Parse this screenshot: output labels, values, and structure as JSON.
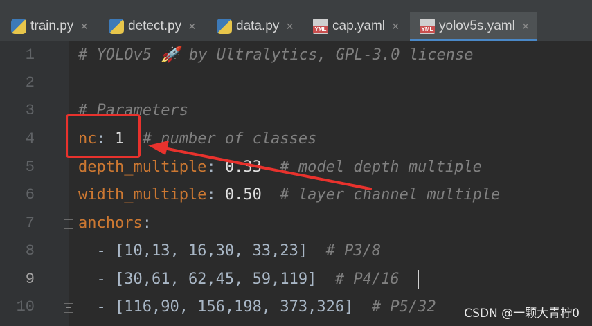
{
  "tabs": [
    {
      "label": "train.py",
      "icon": "python-file-icon"
    },
    {
      "label": "detect.py",
      "icon": "python-file-icon"
    },
    {
      "label": "data.py",
      "icon": "python-file-icon"
    },
    {
      "label": "cap.yaml",
      "icon": "yaml-file-icon"
    },
    {
      "label": "yolov5s.yaml",
      "icon": "yaml-file-icon",
      "active": true
    }
  ],
  "tab_close": "×",
  "yml_badge": "YML",
  "editor": {
    "current_line": 9,
    "lines": [
      {
        "num": "1",
        "comment": "# YOLOv5 🚀 by Ultralytics, GPL-3.0 license"
      },
      {
        "num": "2"
      },
      {
        "num": "3",
        "comment": "# Parameters"
      },
      {
        "num": "4",
        "key": "nc",
        "sep": ": ",
        "value": "1",
        "comment": "# number of classes"
      },
      {
        "num": "5",
        "key": "depth_multiple",
        "sep": ": ",
        "value": "0.33",
        "comment": "# model depth multiple"
      },
      {
        "num": "6",
        "key": "width_multiple",
        "sep": ": ",
        "value": "0.50",
        "comment": "# layer channel multiple"
      },
      {
        "num": "7",
        "key": "anchors",
        "sep": ":"
      },
      {
        "num": "8",
        "text": "  - [10,13, 16,30, 33,23]",
        "comment": "# P3/8"
      },
      {
        "num": "9",
        "text": "  - [30,61, 62,45, 59,119]",
        "comment": "# P4/16"
      },
      {
        "num": "10",
        "text": "  - [116,90, 156,198, 373,326]",
        "comment": "# P5/32"
      }
    ]
  },
  "watermark": "CSDN @一颗大青柠0",
  "colors": {
    "annotation": "#e8322d",
    "comment": "#629755",
    "key": "#cc7832"
  }
}
